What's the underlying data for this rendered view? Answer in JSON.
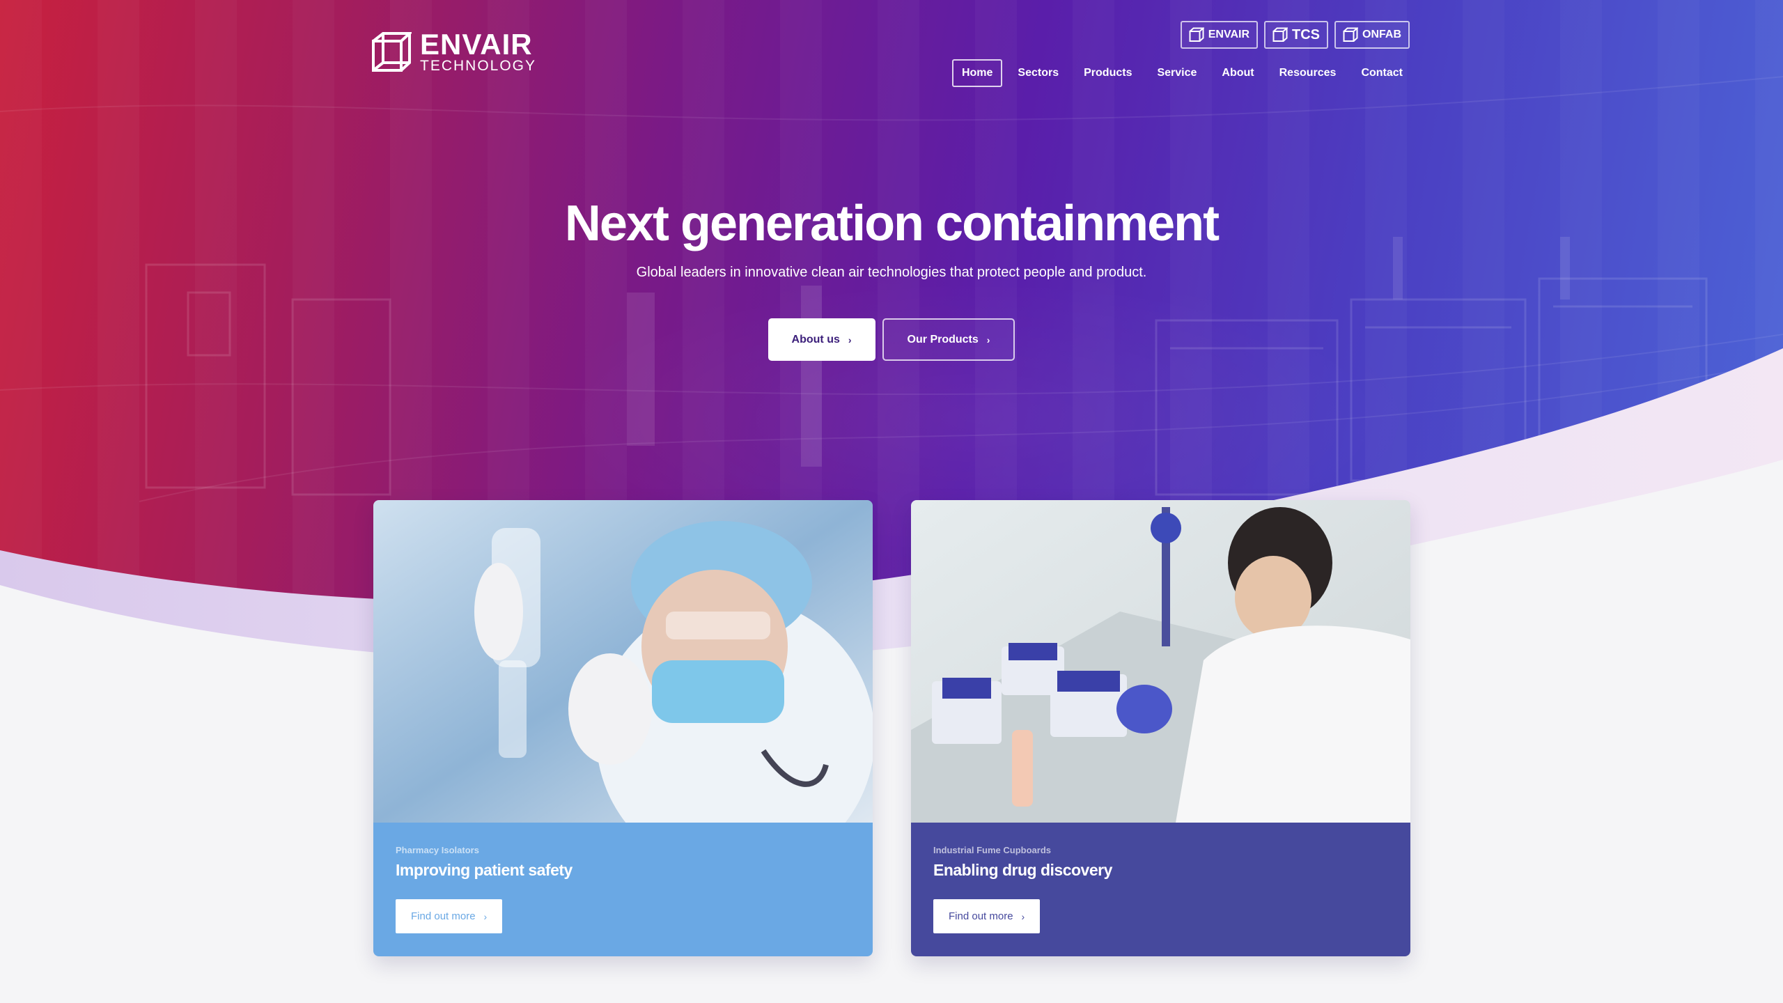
{
  "brand": {
    "logo_main": "ENVAIR",
    "logo_sub": "TECHNOLOGY",
    "switcher": [
      {
        "label": "ENVAIR"
      },
      {
        "label": "TCS"
      },
      {
        "label": "ONFAB"
      }
    ]
  },
  "nav": {
    "items": [
      {
        "label": "Home",
        "active": true
      },
      {
        "label": "Sectors"
      },
      {
        "label": "Products"
      },
      {
        "label": "Service"
      },
      {
        "label": "About"
      },
      {
        "label": "Resources"
      },
      {
        "label": "Contact"
      }
    ]
  },
  "hero": {
    "title": "Next generation containment",
    "subtitle": "Global leaders in innovative clean air technologies that protect people and product.",
    "primary_button": "About us",
    "secondary_button": "Our Products"
  },
  "cards": [
    {
      "category": "Pharmacy Isolators",
      "title": "Improving patient safety",
      "button": "Find out more"
    },
    {
      "category": "Industrial Fume Cupboards",
      "title": "Enabling drug discovery",
      "button": "Find out more"
    }
  ],
  "colors": {
    "hero_left": "#c8203e",
    "hero_mid": "#7a1a86",
    "hero_right": "#4d66d8",
    "card_left_body": "#6aa8e4",
    "card_right_body": "#46499d",
    "page_bg": "#f5f5f7"
  },
  "icons": {
    "logo": "cube-icon",
    "chevron": "chevron-right-icon"
  }
}
